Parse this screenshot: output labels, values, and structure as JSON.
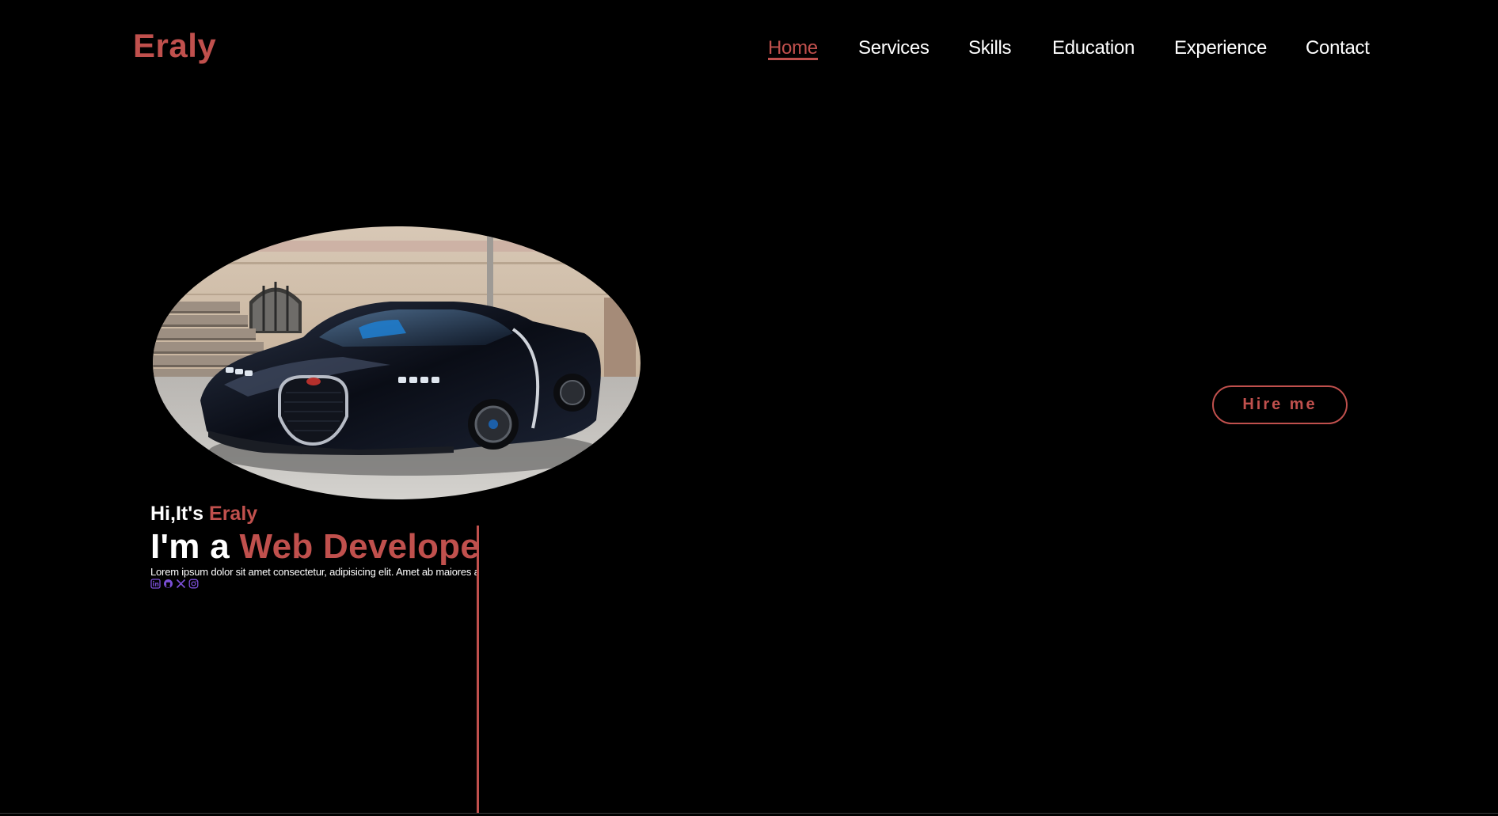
{
  "brand": {
    "logo_text": "Eraly",
    "accent_color": "#c0504d",
    "background_color": "#000000"
  },
  "nav": {
    "items": [
      {
        "label": "Home",
        "active": true
      },
      {
        "label": "Services",
        "active": false
      },
      {
        "label": "Skills",
        "active": false
      },
      {
        "label": "Education",
        "active": false
      },
      {
        "label": "Experience",
        "active": false
      },
      {
        "label": "Contact",
        "active": false
      }
    ]
  },
  "hero": {
    "greeting_prefix": "Hi,It's",
    "greeting_name": "Eraly",
    "role_prefix": "I'm a",
    "role_highlight": "Web Developer",
    "description": "Lorem ipsum dolor sit amet consectetur, adipisicing elit. Amet ab maiores a",
    "image_subject": "black sports car",
    "hire_button_label": "Hire me"
  },
  "social": {
    "icon_color": "#7b4fd6",
    "icons": [
      "linkedin-icon",
      "github-icon",
      "x-icon",
      "instagram-icon"
    ]
  }
}
